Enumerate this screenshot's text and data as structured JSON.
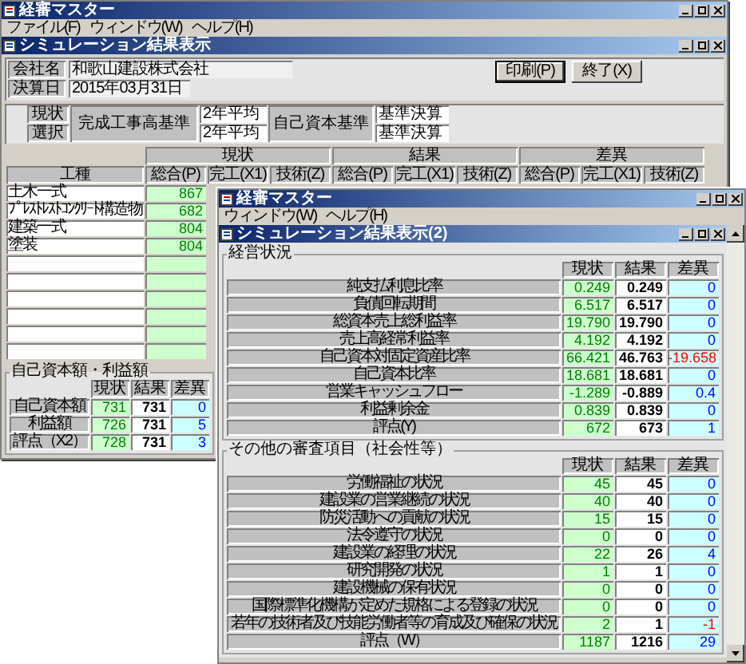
{
  "back_window": {
    "title": "経審マスター",
    "menu": [
      "ファイル(F)",
      "ウィンドウ(W)",
      "ヘルプ(H)"
    ],
    "child": {
      "title": "シミュレーション結果表示",
      "company": [
        {
          "label": "会社名",
          "value": "和歌山建設株式会社"
        },
        {
          "label": "決算日",
          "value": "2015年03月31日"
        }
      ],
      "buttons": [
        {
          "label": "印刷(P)",
          "default": true
        },
        {
          "label": "終了(X)",
          "default": false
        }
      ],
      "basis": {
        "row_labels": [
          "現状",
          "選択"
        ],
        "sales_label": "完成工事高基準",
        "sales_values": [
          "2年平均",
          "2年平均"
        ],
        "capital_label": "自己資本基準",
        "capital_values": [
          "基準決算",
          "基準決算"
        ]
      },
      "works": {
        "groups": [
          "現状",
          "結果",
          "差異"
        ],
        "columns": [
          "工種",
          "総合(P)",
          "完工(X1)",
          "技術(Z)",
          "総合(P)",
          "完工(X1)",
          "技術(Z)",
          "総合(P)",
          "完工(X1)",
          "技術(Z)"
        ],
        "rows": [
          {
            "name": "土木一式",
            "values": [
              "867"
            ]
          },
          {
            "name": "ﾌﾟﾚｽﾄﾚｽﾄｺﾝｸﾘｰﾄ構造物",
            "values": [
              "682"
            ]
          },
          {
            "name": "建築一式",
            "values": [
              "804"
            ]
          },
          {
            "name": "塗装",
            "values": [
              "804"
            ]
          },
          {},
          {},
          {},
          {},
          {},
          {}
        ]
      },
      "capital": {
        "title": "自己資本額・利益額",
        "columns": [
          "現状",
          "結果",
          "差異"
        ],
        "rows": [
          {
            "label": "自己資本額",
            "current": "731",
            "result": "731",
            "diff": "0",
            "negative": false
          },
          {
            "label": "利益額",
            "current": "726",
            "result": "731",
            "diff": "5",
            "negative": false
          },
          {
            "label": "評点（X2）",
            "current": "728",
            "result": "731",
            "diff": "3",
            "negative": false
          }
        ]
      }
    }
  },
  "front_window": {
    "title": "経審マスター",
    "menu": [
      "ウィンドウ(W)",
      "ヘルプ(H)"
    ],
    "child": {
      "title": "シミュレーション結果表示(2)",
      "sections": [
        {
          "title": "経営状況",
          "columns": [
            "現状",
            "結果",
            "差異"
          ],
          "rows": [
            {
              "label": "純支払利息比率",
              "current": "0.249",
              "result": "0.249",
              "diff": "0",
              "negative": false
            },
            {
              "label": "負債回転期間",
              "current": "6.517",
              "result": "6.517",
              "diff": "0",
              "negative": false
            },
            {
              "label": "総資本売上総利益率",
              "current": "19.790",
              "result": "19.790",
              "diff": "0",
              "negative": false
            },
            {
              "label": "売上高経常利益率",
              "current": "4.192",
              "result": "4.192",
              "diff": "0",
              "negative": false
            },
            {
              "label": "自己資本対固定資産比率",
              "current": "66.421",
              "result": "46.763",
              "diff": "-19.658",
              "negative": true
            },
            {
              "label": "自己資本比率",
              "current": "18.681",
              "result": "18.681",
              "diff": "0",
              "negative": false
            },
            {
              "label": "営業キャッシュフロー",
              "current": "-1.289",
              "result": "-0.889",
              "diff": "0.4",
              "negative": false
            },
            {
              "label": "利益剰余金",
              "current": "0.839",
              "result": "0.839",
              "diff": "0",
              "negative": false
            },
            {
              "label": "評点(Y)",
              "current": "672",
              "result": "673",
              "diff": "1",
              "negative": false
            }
          ]
        },
        {
          "title": "その他の審査項目（社会性等）",
          "columns": [
            "現状",
            "結果",
            "差異"
          ],
          "rows": [
            {
              "label": "労働福祉の状況",
              "current": "45",
              "result": "45",
              "diff": "0",
              "negative": false
            },
            {
              "label": "建設業の営業継続の状況",
              "current": "40",
              "result": "40",
              "diff": "0",
              "negative": false
            },
            {
              "label": "防災活動への貢献の状況",
              "current": "15",
              "result": "15",
              "diff": "0",
              "negative": false
            },
            {
              "label": "法令遵守の状況",
              "current": "0",
              "result": "0",
              "diff": "0",
              "negative": false
            },
            {
              "label": "建設業の経理の状況",
              "current": "22",
              "result": "26",
              "diff": "4",
              "negative": false
            },
            {
              "label": "研究開発の状況",
              "current": "1",
              "result": "1",
              "diff": "0",
              "negative": false
            },
            {
              "label": "建設機械の保有状況",
              "current": "0",
              "result": "0",
              "diff": "0",
              "negative": false
            },
            {
              "label": "国際標準化機構が定めた規格による登録の状況",
              "current": "0",
              "result": "0",
              "diff": "0",
              "negative": false
            },
            {
              "label": "若年の技術者及び技能労働者等の育成及び確保の状況",
              "current": "2",
              "result": "1",
              "diff": "-1",
              "negative": true
            },
            {
              "label": "評点（W）",
              "current": "1187",
              "result": "1216",
              "diff": "29",
              "negative": false
            }
          ]
        }
      ]
    }
  }
}
